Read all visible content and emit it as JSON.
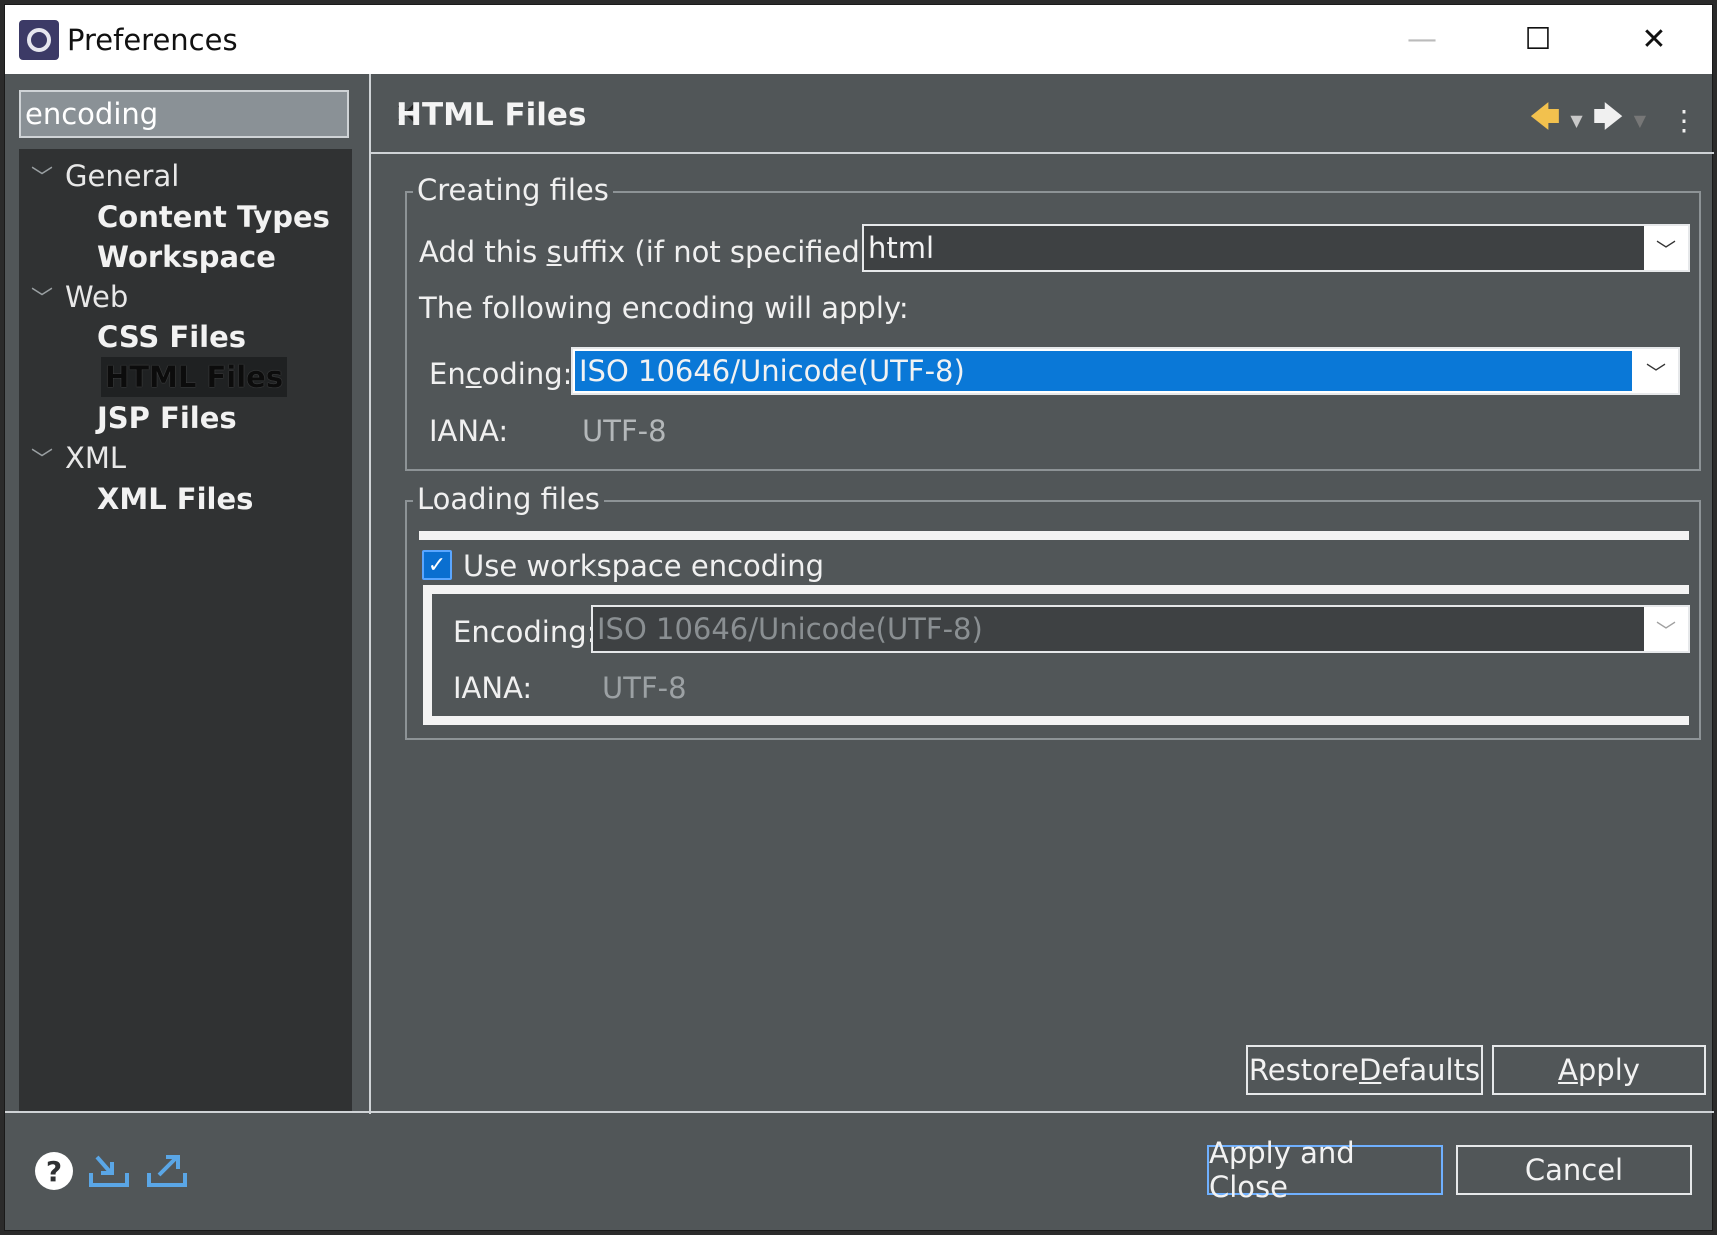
{
  "window": {
    "title": "Preferences",
    "controls": {
      "minimize": "—",
      "maximize": "☐",
      "close": "✕"
    }
  },
  "filter": {
    "value": "encoding",
    "clear_icon": "✕"
  },
  "tree": {
    "items": [
      {
        "label": "General",
        "level": 0,
        "expanded": true
      },
      {
        "label": "Content Types",
        "level": 1
      },
      {
        "label": "Workspace",
        "level": 1
      },
      {
        "label": "Web",
        "level": 0,
        "expanded": true
      },
      {
        "label": "CSS Files",
        "level": 1
      },
      {
        "label": "HTML Files",
        "level": 1,
        "selected": true
      },
      {
        "label": "JSP Files",
        "level": 1
      },
      {
        "label": "XML",
        "level": 0,
        "expanded": true
      },
      {
        "label": "XML Files",
        "level": 1
      }
    ]
  },
  "page": {
    "title": "HTML Files",
    "nav": {
      "back_icon": "back-arrow-icon",
      "forward_icon": "forward-arrow-icon",
      "menu_icon": "view-menu-icon"
    }
  },
  "creating": {
    "group_label": "Creating files",
    "suffix_label_pre": "Add this ",
    "suffix_label_u": "s",
    "suffix_label_post": "uffix (if not specified):",
    "suffix_value": "html",
    "apply_text": "The following encoding will apply:",
    "encoding_label_pre": "En",
    "encoding_label_u": "c",
    "encoding_label_post": "oding:",
    "encoding_value": "ISO 10646/Unicode(UTF-8)",
    "iana_label": "IANA:",
    "iana_value": "UTF-8"
  },
  "loading": {
    "group_label": "Loading files",
    "use_workspace_label": "Use workspace encoding",
    "use_workspace_checked": true,
    "encoding_label": "Encoding:",
    "encoding_value": "ISO 10646/Unicode(UTF-8)",
    "iana_label": "IANA:",
    "iana_value": "UTF-8"
  },
  "buttons": {
    "restore_defaults_pre": "Restore ",
    "restore_defaults_u": "D",
    "restore_defaults_post": "efaults",
    "apply_u": "A",
    "apply_post": "pply",
    "apply_and_close": "Apply and Close",
    "cancel": "Cancel"
  },
  "colors": {
    "accent": "#0a78d7",
    "background": "#515658",
    "tree_background": "#303233",
    "back_arrow": "#f2c14e"
  }
}
